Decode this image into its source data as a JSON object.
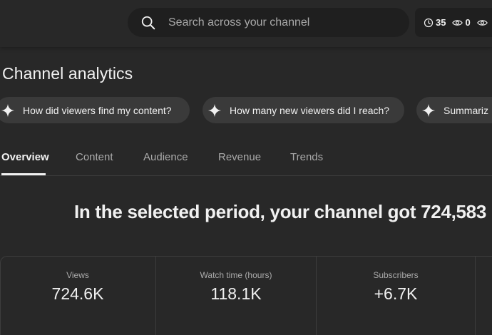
{
  "header": {
    "search_placeholder": "Search across your channel",
    "stats": {
      "history_count": "35",
      "views_count": "0"
    }
  },
  "page": {
    "title": "Channel analytics"
  },
  "chips": [
    {
      "label": "How did viewers find my content?"
    },
    {
      "label": "How many new viewers did I reach?"
    },
    {
      "label": "Summariz"
    }
  ],
  "tabs": [
    {
      "label": "Overview",
      "active": true
    },
    {
      "label": "Content"
    },
    {
      "label": "Audience"
    },
    {
      "label": "Revenue"
    },
    {
      "label": "Trends"
    }
  ],
  "headline": "In the selected period, your channel got 724,583",
  "metrics": [
    {
      "label": "Views",
      "value": "724.6K"
    },
    {
      "label": "Watch time (hours)",
      "value": "118.1K"
    },
    {
      "label": "Subscribers",
      "value": "+6.7K"
    }
  ],
  "colors": {
    "background": "#282828",
    "surface": "#1f1f1f",
    "chip": "#3a3a3a",
    "text": "#f1f1f1",
    "muted_text": "#aaaaaa",
    "divider": "#3d3d3d"
  },
  "icons": {
    "search": "search-icon",
    "history": "clock-icon",
    "views": "eye-icon",
    "chip": "sparkle-icon"
  }
}
